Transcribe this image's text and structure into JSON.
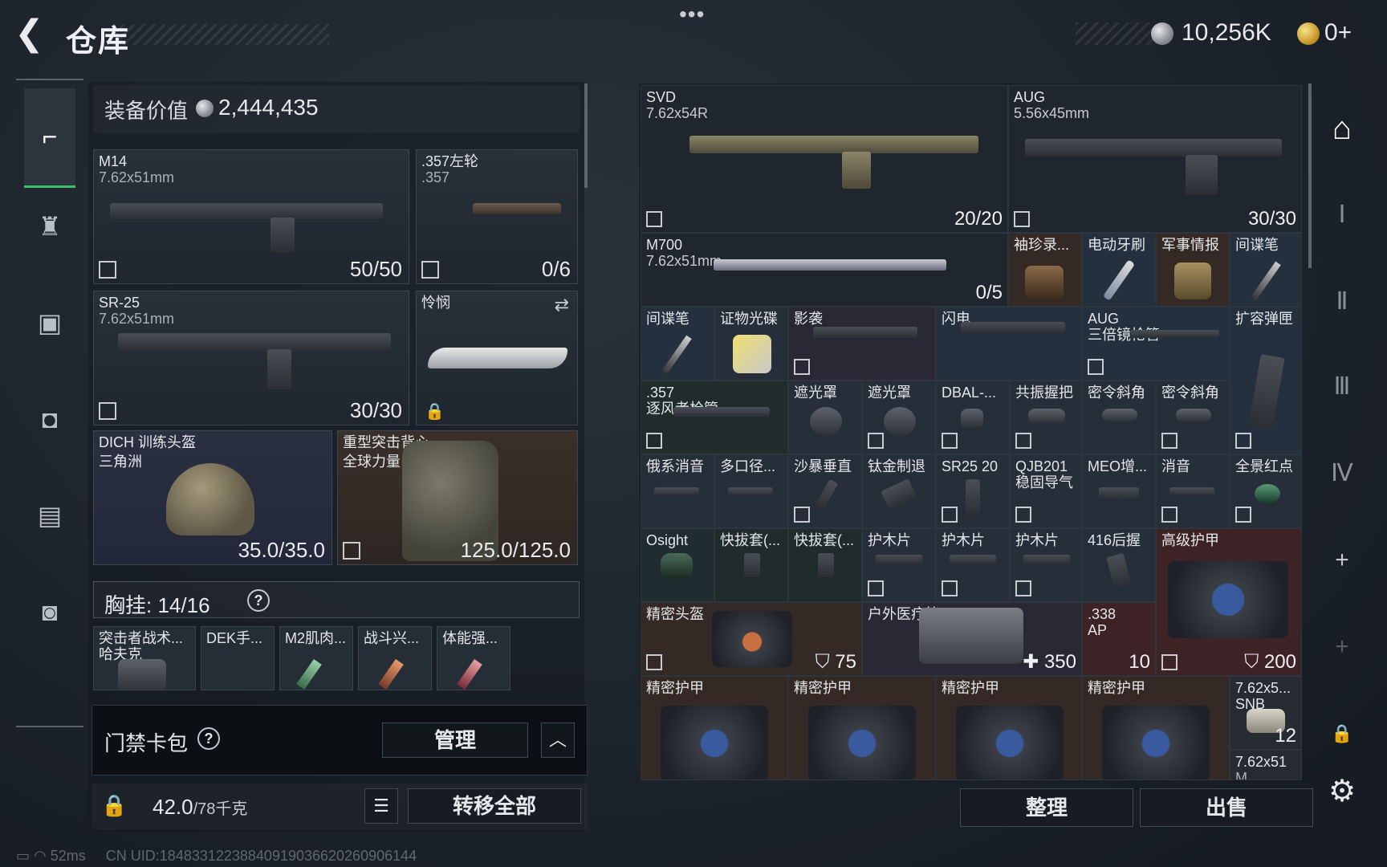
{
  "header": {
    "back_icon": "back-arrow-icon",
    "title": "仓库",
    "more_dots": "•••",
    "money": "10,256K",
    "gold": "0+"
  },
  "left_nav": {
    "items": [
      {
        "icon": "pistol-icon",
        "glyph": "⌐",
        "active": true
      },
      {
        "icon": "armor-icon",
        "glyph": "♜"
      },
      {
        "icon": "vest-icon",
        "glyph": "▣"
      },
      {
        "icon": "backpack-icon",
        "glyph": "◘"
      },
      {
        "icon": "container-icon",
        "glyph": "▤"
      },
      {
        "icon": "briefcase-icon",
        "glyph": "◙"
      }
    ]
  },
  "equipment": {
    "value_label": "装备价值",
    "value": "2,444,435",
    "primary": {
      "name": "M14",
      "ammo": "7.62x51mm",
      "count": "50/50"
    },
    "revolver": {
      "name": ".357左轮",
      "ammo": ".357",
      "count": "0/6"
    },
    "secondary": {
      "name": "SR-25",
      "ammo": "7.62x51mm",
      "count": "30/30"
    },
    "melee": {
      "name": "怜悯",
      "swap_icon": "swap-icon"
    },
    "helmet": {
      "name": "DICH 训练头盔",
      "sub": "三角洲",
      "durability": "35.0/35.0"
    },
    "armor": {
      "name": "重型突击背心",
      "sub": "全球力量",
      "durability": "125.0/125.0"
    },
    "rig_label": "胸挂:",
    "rig_capacity": "14/16",
    "rig_help": "?",
    "rig_items": [
      {
        "name": "突击者战术...",
        "sub": "哈夫克"
      },
      {
        "name": "DEK手..."
      },
      {
        "name": "M2肌肉..."
      },
      {
        "name": "战斗兴..."
      },
      {
        "name": "体能强..."
      }
    ],
    "keybag_label": "门禁卡包",
    "keybag_help": "?",
    "manage_label": "管理",
    "collapse_glyph": "︿",
    "weight": "42.0",
    "weight_max": "/78千克",
    "list_glyph": "☰",
    "transfer_label": "转移全部"
  },
  "storage": {
    "cells": {
      "svd": {
        "name": "SVD",
        "sub": "7.62x54R",
        "count": "20/20"
      },
      "aug": {
        "name": "AUG",
        "sub": "5.56x45mm",
        "count": "30/30"
      },
      "m700": {
        "name": "M700",
        "sub": "7.62x51mm",
        "count": "0/5"
      },
      "r1c5": {
        "name": "袖珍录..."
      },
      "r1c6": {
        "name": "电动牙刷"
      },
      "r1c7": {
        "name": "军事情报"
      },
      "r1c8": {
        "name": "间谍笔"
      },
      "r2c1": {
        "name": "间谍笔"
      },
      "r2c2": {
        "name": "证物光碟"
      },
      "r2c3": {
        "name": "影袭"
      },
      "r2c5": {
        "name": "闪电"
      },
      "r2c7": {
        "name": "AUG",
        "sub": "三倍镜枪管"
      },
      "r2c9": {
        "name": "扩容弹匣"
      },
      "r3c1": {
        "name": ".357",
        "sub": "逐风者枪管"
      },
      "r3c3": {
        "name": "遮光罩"
      },
      "r3c4": {
        "name": "遮光罩"
      },
      "r3c5": {
        "name": "DBAL-..."
      },
      "r3c6": {
        "name": "共振握把"
      },
      "r3c7": {
        "name": "密令斜角"
      },
      "r3c8": {
        "name": "密令斜角"
      },
      "r4c1": {
        "name": "俄系消音"
      },
      "r4c2": {
        "name": "多口径..."
      },
      "r4c3": {
        "name": "沙暴垂直"
      },
      "r4c4": {
        "name": "钛金制退"
      },
      "r4c5": {
        "name": "SR25 20"
      },
      "r4c6": {
        "name": "QJB201",
        "sub": "稳固导气"
      },
      "r4c7": {
        "name": "MEO增..."
      },
      "r4c8": {
        "name": "消音"
      },
      "r4c9": {
        "name": "全景红点"
      },
      "r5c1": {
        "name": "Osight"
      },
      "r5c2": {
        "name": "快拔套(..."
      },
      "r5c3": {
        "name": "快拔套(..."
      },
      "r5c4": {
        "name": "护木片"
      },
      "r5c5": {
        "name": "护木片"
      },
      "r5c6": {
        "name": "护木片"
      },
      "r5c7": {
        "name": "416后握"
      },
      "r5c8": {
        "name": "高级护甲",
        "count": "200"
      },
      "r6c1": {
        "name": "精密头盔",
        "count": "75"
      },
      "r6c4": {
        "name": "户外医疗箱",
        "count": "350"
      },
      "r6c7": {
        "name": ".338",
        "sub": "AP",
        "count": "10"
      },
      "r7c1": {
        "name": "精密护甲"
      },
      "r7c3": {
        "name": "精密护甲"
      },
      "r7c5": {
        "name": "精密护甲"
      },
      "r7c7": {
        "name": "精密护甲"
      },
      "r7c9": {
        "name": "7.62x5...",
        "sub": "SNB",
        "count": "12"
      },
      "r8c9": {
        "name": "7.62x51",
        "sub": "M..."
      }
    },
    "sort_label": "整理",
    "sell_label": "出售"
  },
  "right_sidebar": {
    "items": [
      {
        "icon": "warehouse-icon",
        "glyph": "⌂"
      },
      {
        "icon": "extension-1-icon",
        "glyph": "Ⅰ"
      },
      {
        "icon": "extension-2-icon",
        "glyph": "Ⅱ"
      },
      {
        "icon": "extension-3-icon",
        "glyph": "Ⅲ"
      },
      {
        "icon": "extension-4-icon",
        "glyph": "Ⅳ"
      },
      {
        "icon": "add-icon",
        "glyph": "+"
      },
      {
        "icon": "add-disabled-icon",
        "glyph": "+"
      },
      {
        "icon": "lock-icon",
        "glyph": "🔒"
      },
      {
        "icon": "settings-gear-icon",
        "glyph": "⚙"
      }
    ]
  },
  "status": {
    "ping": "52ms",
    "uid": "CN UID:18483312238840919036620260906144"
  }
}
